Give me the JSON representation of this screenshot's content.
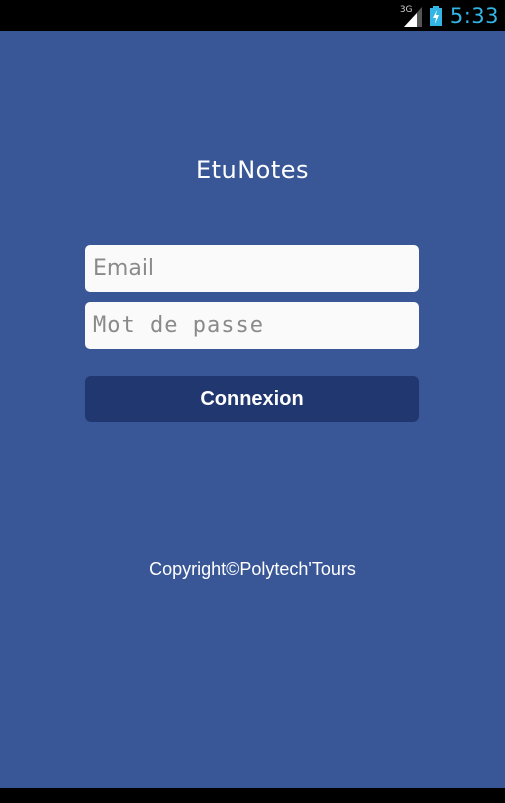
{
  "status_bar": {
    "network_label": "3G",
    "time": "5:33",
    "icons": [
      "signal-icon",
      "battery-charging-icon"
    ]
  },
  "app": {
    "title": "EtuNotes",
    "email": {
      "placeholder": "Email",
      "value": ""
    },
    "password": {
      "placeholder": "Mot de passe",
      "value": ""
    },
    "login_button": "Connexion",
    "copyright": "Copyright©Polytech'Tours"
  },
  "colors": {
    "background": "#395797",
    "button": "#213770",
    "clock": "#33b5e5",
    "field": "#fafafa"
  }
}
